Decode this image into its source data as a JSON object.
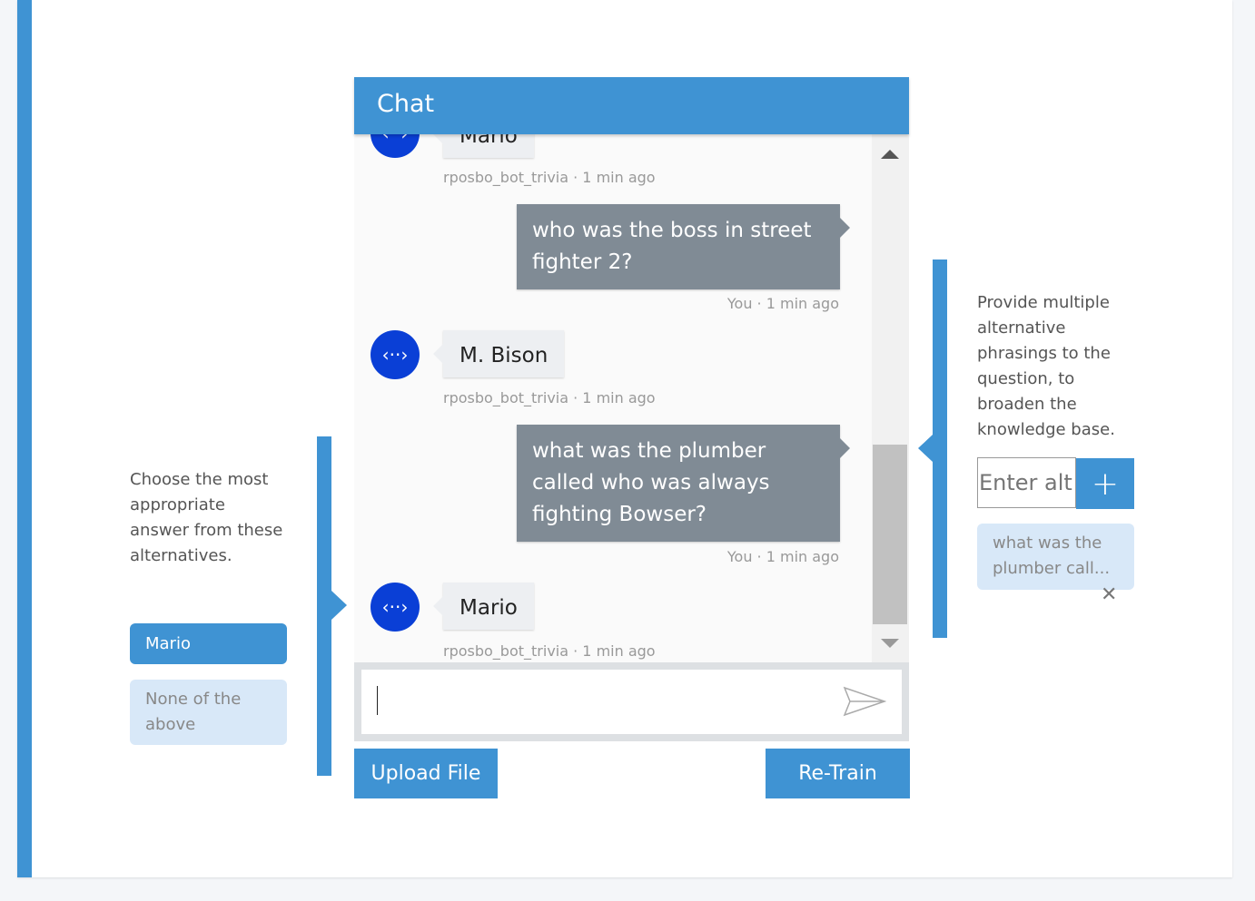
{
  "left_panel": {
    "instruction": "Choose the most appropriate answer from these alternatives.",
    "choices": [
      {
        "label": "Mario",
        "selected": true
      },
      {
        "label": "None of the above",
        "selected": false
      }
    ]
  },
  "chat": {
    "title": "Chat",
    "messages": [
      {
        "from": "bot",
        "text": "Mario",
        "meta": "rposbo_bot_trivia · 1 min ago"
      },
      {
        "from": "user",
        "text": "who was the boss in street fighter 2?",
        "meta": "You · 1 min ago"
      },
      {
        "from": "bot",
        "text": "M. Bison",
        "meta": "rposbo_bot_trivia · 1 min ago"
      },
      {
        "from": "user",
        "text": "what was the plumber called who was always fighting Bowser?",
        "meta": "You · 1 min ago"
      },
      {
        "from": "bot",
        "text": "Mario",
        "meta": "rposbo_bot_trivia · 1 min ago"
      }
    ],
    "input_value": "",
    "send_icon": "send-icon"
  },
  "buttons": {
    "upload": "Upload File",
    "retrain": "Re-Train"
  },
  "right_panel": {
    "instruction": "Provide multiple alternative phrasings to the question, to broaden the knowledge base.",
    "input_placeholder": "Enter alt",
    "add_icon": "plus-icon",
    "alternatives": [
      {
        "text": "what was the plumber call..."
      }
    ]
  },
  "colors": {
    "accent": "#3f93d3",
    "bot_avatar": "#0a3fd6",
    "user_bubble": "#808b95",
    "chip": "#d8e8f8"
  }
}
